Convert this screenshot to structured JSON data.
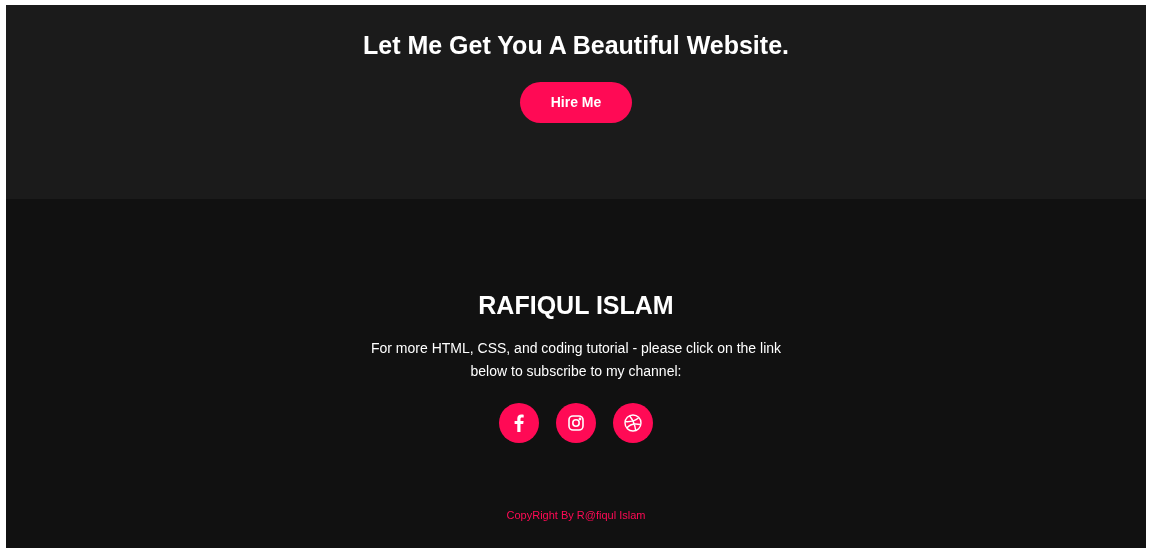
{
  "hero": {
    "heading": "Let Me Get You A Beautiful Website.",
    "button": "Hire Me"
  },
  "footer": {
    "title": "RAFIQUL ISLAM",
    "description": "For more HTML, CSS, and coding tutorial - please click on the link below to subscribe to my channel:",
    "social_links": [
      {
        "kind": "facebook"
      },
      {
        "kind": "instagram"
      },
      {
        "kind": "dribbble"
      }
    ],
    "copyright": "CopyRight By R@fiqul Islam"
  }
}
